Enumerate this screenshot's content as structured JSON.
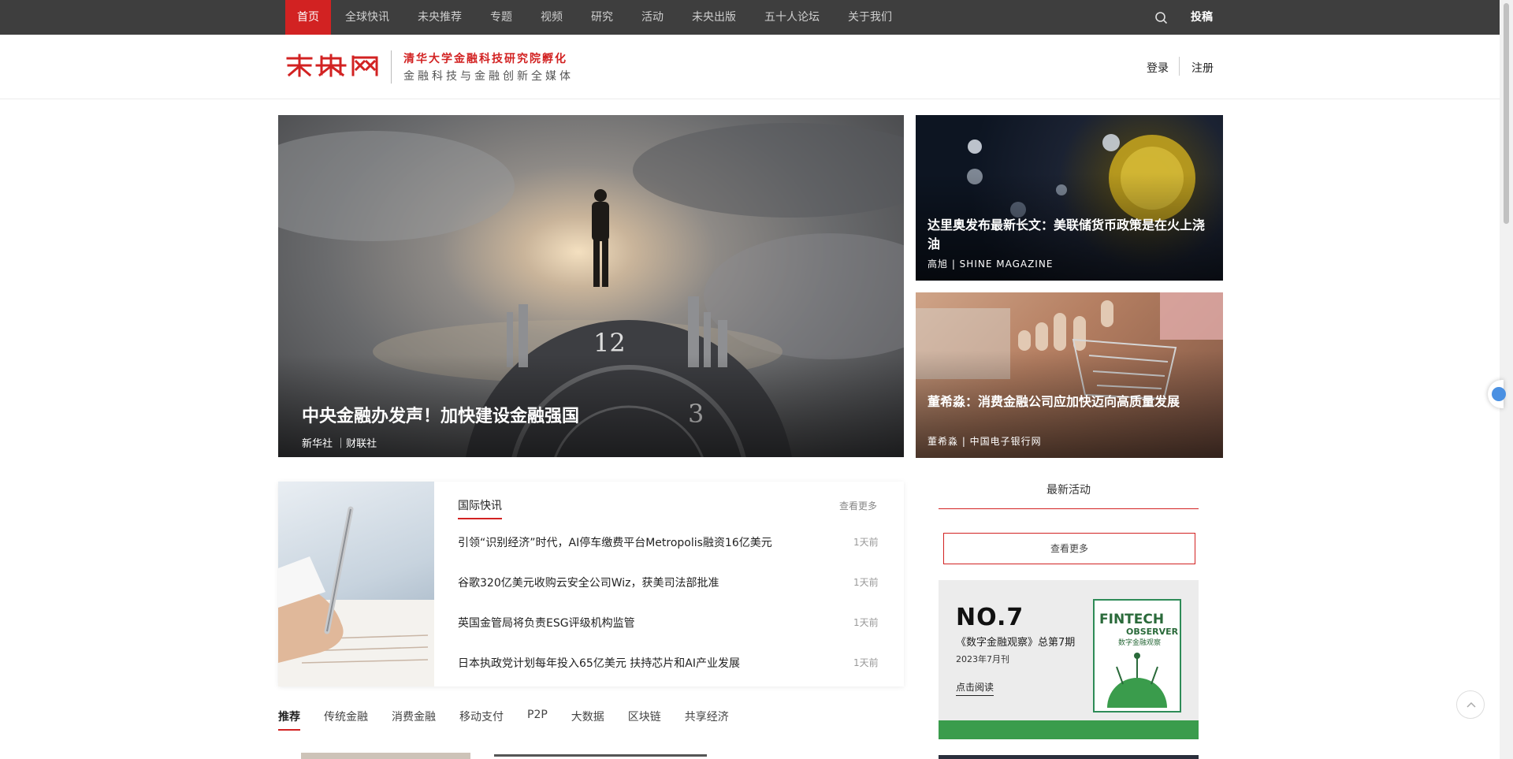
{
  "topnav": {
    "items": [
      "首页",
      "全球快讯",
      "未央推荐",
      "专题",
      "视频",
      "研究",
      "活动",
      "未央出版",
      "五十人论坛",
      "关于我们"
    ],
    "contribute": "投稿"
  },
  "header": {
    "slogan_line1": "清华大学金融科技研究院孵化",
    "slogan_line2": "金融科技与金融创新全媒体",
    "login": "登录",
    "register": "注册",
    "brand_color": "#d22222"
  },
  "hero": {
    "main": {
      "title": "中央金融办发声！加快建设金融强国",
      "sources": "新华社 ｜财联社"
    },
    "side": [
      {
        "title": "达里奥发布最新长文：美联储货币政策是在火上浇油",
        "sources": "高旭 | SHINE MAGAZINE"
      },
      {
        "title": "董希淼：消费金融公司应加快迈向高质量发展",
        "sources": "董希淼 | 中国电子银行网"
      }
    ]
  },
  "news": {
    "heading": "国际快讯",
    "more": "查看更多",
    "items": [
      {
        "title": "引领“识别经济”时代，AI停车缴费平台Metropolis融资16亿美元",
        "time": "1天前"
      },
      {
        "title": "谷歌320亿美元收购云安全公司Wiz，获美司法部批准",
        "time": "1天前"
      },
      {
        "title": "英国金管局将负责ESG评级机构监管",
        "time": "1天前"
      },
      {
        "title": "日本执政党计划每年投入65亿美元 扶持芯片和AI产业发展",
        "time": "1天前"
      }
    ]
  },
  "tabs": [
    "推荐",
    "传统金融",
    "消费金融",
    "移动支付",
    "P2P",
    "大数据",
    "区块链",
    "共享经济"
  ],
  "sidebar": {
    "activity_title": "最新活动",
    "activity_more": "查看更多",
    "ad": {
      "number": "NO.7",
      "issue": "《数字金融观察》总第7期",
      "date": "2023年7月刊",
      "read": "点击阅读",
      "cover_title1": "FINTECH",
      "cover_title2": "OBSERVER",
      "cover_subtitle": "数字金融观察"
    }
  }
}
